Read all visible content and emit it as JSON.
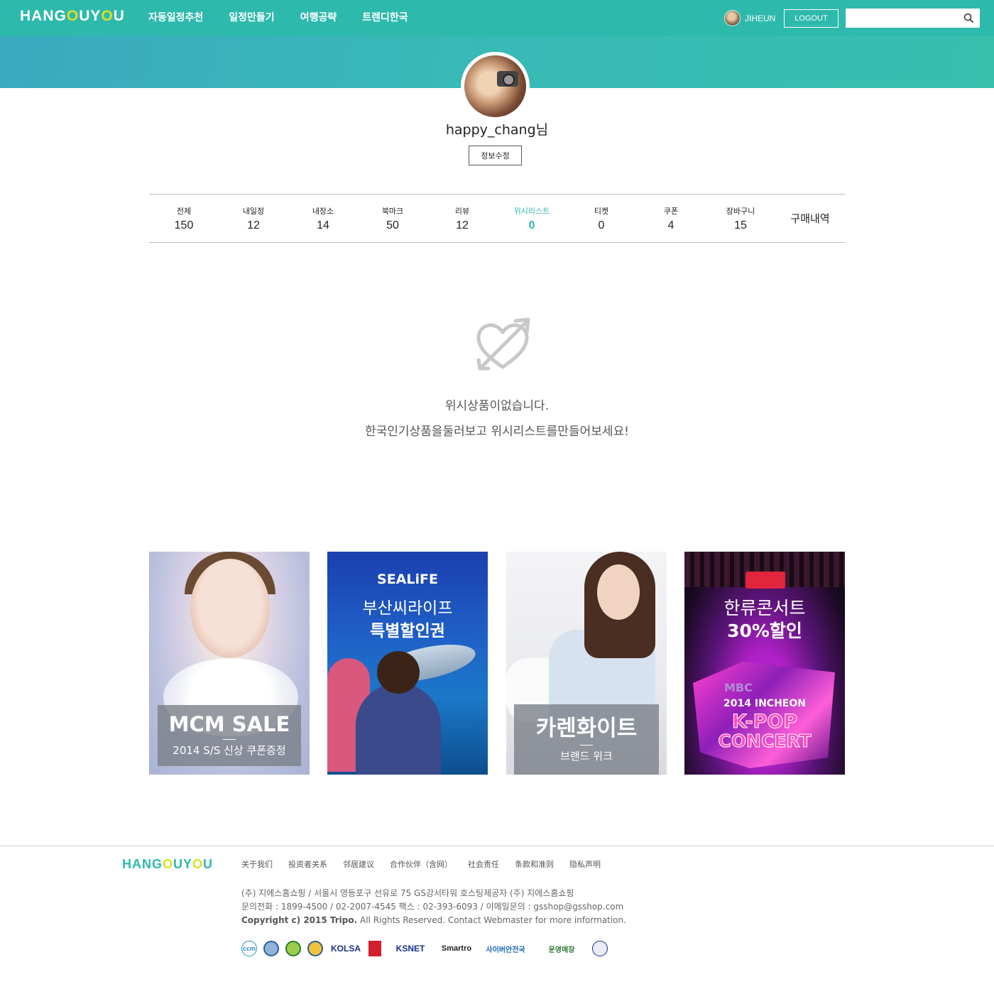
{
  "header": {
    "logo": {
      "pre": "HANG",
      "o1": "O",
      "mid": "UY",
      "o2": "O",
      "post": "U"
    },
    "nav": [
      "자동일정추천",
      "일정만들기",
      "여행공략",
      "트렌디한국"
    ],
    "user_name": "JIHEUN",
    "logout_label": "LOGOUT",
    "search_placeholder": ""
  },
  "profile": {
    "username": "happy_chang님",
    "edit_label": "정보수정"
  },
  "stats": [
    {
      "label": "전체",
      "value": "150"
    },
    {
      "label": "내일정",
      "value": "12"
    },
    {
      "label": "내장소",
      "value": "14"
    },
    {
      "label": "북마크",
      "value": "50"
    },
    {
      "label": "리뷰",
      "value": "12"
    },
    {
      "label": "위시리스트",
      "value": "0",
      "active": true
    },
    {
      "label": "티켓",
      "value": "0"
    },
    {
      "label": "쿠폰",
      "value": "4"
    },
    {
      "label": "장바구니",
      "value": "15"
    },
    {
      "label": "구매내역",
      "value": null
    }
  ],
  "empty": {
    "line1": "위시상품이없습니다.",
    "line2": "한국인기상품을둘러보고 위시리스트를만들어보세요!"
  },
  "promos": [
    {
      "title": "MCM SALE",
      "subtitle": "2014 S/S 신상 쿠폰증정"
    },
    {
      "brand": "SEALiFE",
      "line1": "부산씨라이프",
      "line2": "특별할인권"
    },
    {
      "title": "카렌화이트",
      "subtitle": "브랜드 위크"
    },
    {
      "line1": "한류콘서트",
      "line2": "30%할인",
      "mbc": "MBC",
      "event": "2014 INCHEON",
      "kpop": "K-POP",
      "concert": "CONCERT"
    }
  ],
  "footer": {
    "links": [
      "关于我们",
      "投资者关系",
      "邻居建议",
      "合作伙伴（含网）",
      "社会责任",
      "条款和准则",
      "隐私声明"
    ],
    "address": "(주) 지에스홈쇼핑  / 서울시 영등포구 선유로 75 GS강서타워 호스팅제공자 (주) 지에스홈쇼핑",
    "contact": "문의전화 : 1899-4500 / 02-2007-4545 팩스 : 02-393-6093 / 이메일문의 : gsshop@gsshop.com",
    "copyright_bold": "Copyright c) 2015 Tripo.",
    "copyright_rest": " All Rights Reserved. Contact Webmaster for more information.",
    "badges": [
      "ccm",
      "",
      "",
      "",
      "KOLSA",
      "",
      "KSNET",
      "Smartro",
      "사이버안전국",
      "운영매장",
      ""
    ]
  },
  "colors": {
    "accent": "#2eb9ad",
    "logo_o": "#d9e021"
  }
}
